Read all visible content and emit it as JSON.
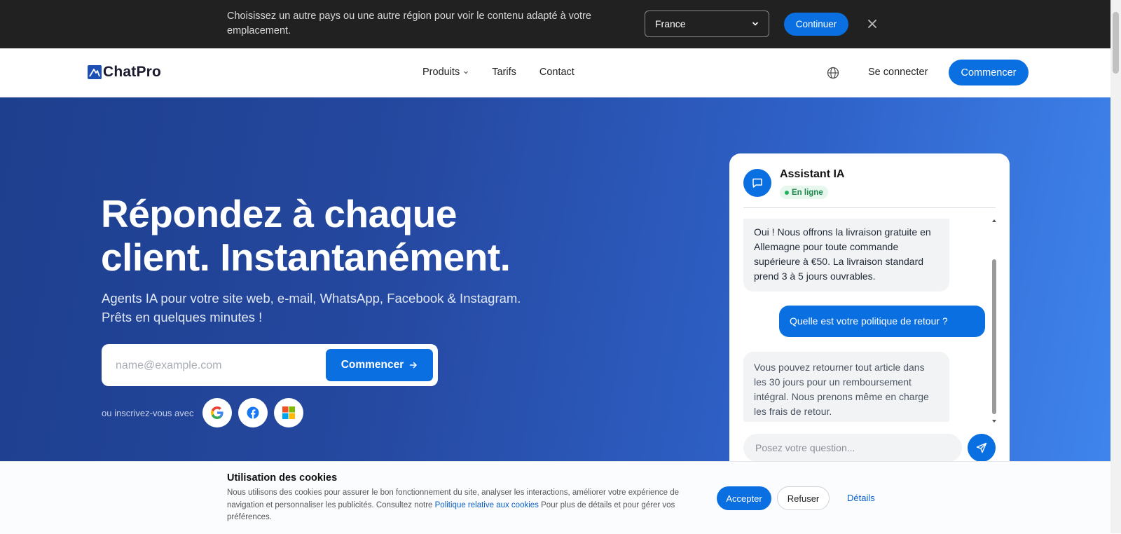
{
  "region_banner": {
    "message": "Choisissez un autre pays ou une autre région pour voir le contenu adapté à votre emplacement.",
    "selected_country": "France",
    "continue_label": "Continuer"
  },
  "header": {
    "logo_text": "ChatPro",
    "nav": [
      {
        "label": "Produits",
        "has_dropdown": true
      },
      {
        "label": "Tarifs",
        "has_dropdown": false
      },
      {
        "label": "Contact",
        "has_dropdown": false
      }
    ],
    "login_label": "Se connecter",
    "cta_label": "Commencer"
  },
  "hero": {
    "title_line1": "Répondez à chaque",
    "title_line2": "client. Instantanément.",
    "subtitle_line1": "Agents IA pour votre site web, e-mail, WhatsApp, Facebook & Instagram.",
    "subtitle_line2": "Prêts en quelques minutes !",
    "email_placeholder": "name@example.com",
    "signup_label": "Commencer",
    "social_label": "ou inscrivez-vous avec",
    "social_icons": [
      "google-icon",
      "facebook-icon",
      "microsoft-icon"
    ]
  },
  "chat": {
    "title": "Assistant IA",
    "status": "En ligne",
    "messages": [
      {
        "role": "bot",
        "text": "Oui ! Nous offrons la livraison gratuite en Allemagne pour toute commande supérieure à €50. La livraison standard prend 3 à 5 jours ouvrables."
      },
      {
        "role": "user",
        "text": "Quelle est votre politique de retour ?"
      },
      {
        "role": "bot",
        "text": "Vous pouvez retourner tout article dans les 30 jours pour un remboursement intégral. Nous prenons même en charge les frais de retour."
      }
    ],
    "input_placeholder": "Posez votre question..."
  },
  "cookie": {
    "title": "Utilisation des cookies",
    "text_before": "Nous utilisons des cookies pour assurer le bon fonctionnement du site, analyser les interactions, améliorer votre expérience de navigation et personnaliser les publicités. Consultez notre ",
    "link_text": "Politique relative aux cookies",
    "text_after": " Pour plus de détails et pour gérer vos préférences.",
    "accept_label": "Accepter",
    "refuse_label": "Refuser",
    "details_label": "Détails"
  },
  "colors": {
    "primary": "#0a6fe0",
    "banner_bg": "#212121",
    "hero_start": "#1e3f8d",
    "hero_end": "#3f86ee",
    "online": "#22b35e"
  }
}
